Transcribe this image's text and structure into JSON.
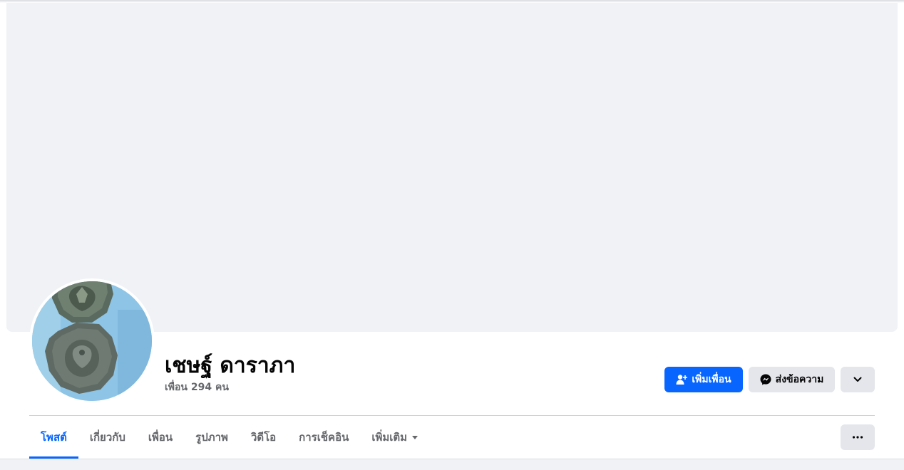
{
  "profile": {
    "name": "เชษฐ์ ดาราภา",
    "friends_count": "เพื่อน 294 คน"
  },
  "actions": {
    "add_friend_label": "เพิ่มเพื่อน",
    "message_label": "ส่งข้อความ"
  },
  "tabs": [
    {
      "label": "โพสต์",
      "active": true
    },
    {
      "label": "เกี่ยวกับ",
      "active": false
    },
    {
      "label": "เพื่อน",
      "active": false
    },
    {
      "label": "รูปภาพ",
      "active": false
    },
    {
      "label": "วิดีโอ",
      "active": false
    },
    {
      "label": "การเช็คอิน",
      "active": false
    },
    {
      "label": "เพิ่มเติม",
      "active": false
    }
  ],
  "colors": {
    "accent": "#0866ff",
    "cover": "#f0f2f5",
    "secondary_button": "#e4e6eb",
    "muted_text": "#65676b"
  },
  "icons": [
    "add-friend-icon",
    "messenger-icon",
    "chevron-down-icon",
    "caret-down-icon",
    "more-dots-icon"
  ]
}
